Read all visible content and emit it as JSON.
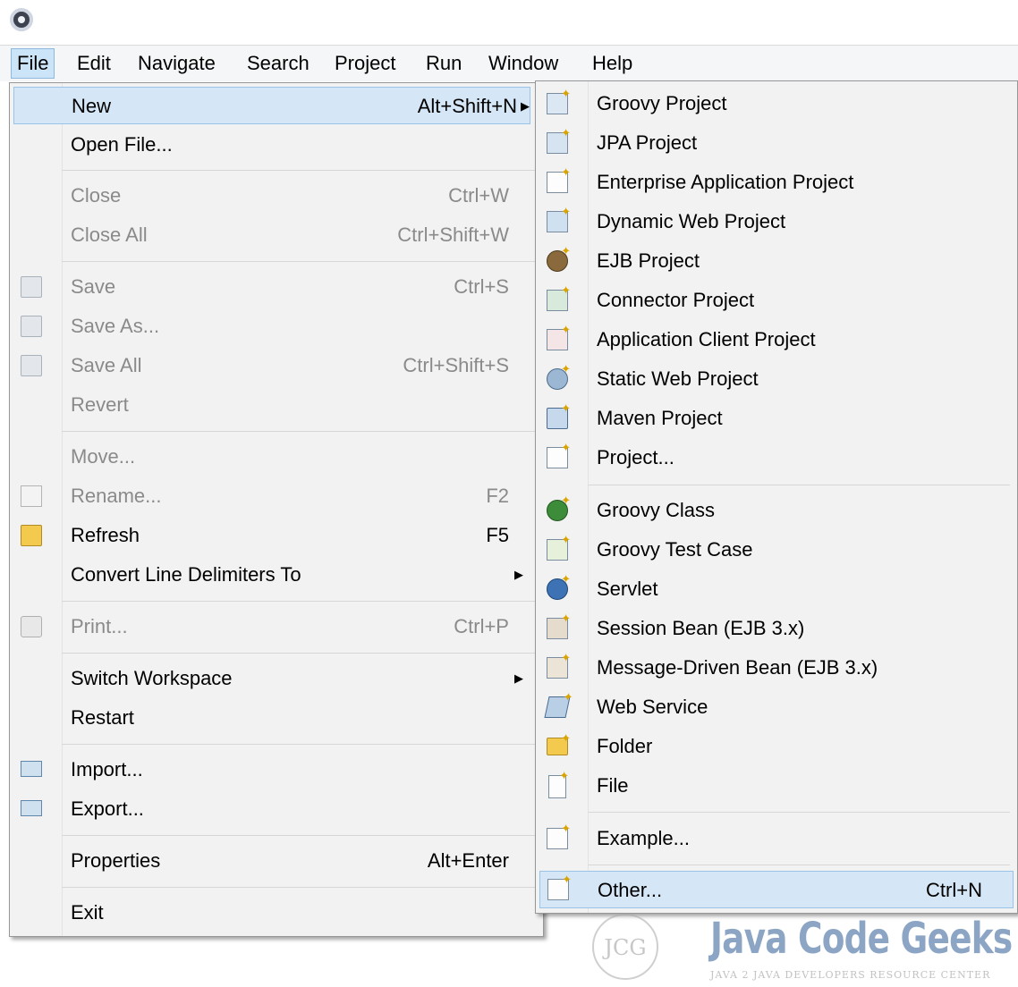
{
  "menubar": {
    "items": [
      "File",
      "Edit",
      "Navigate",
      "Search",
      "Project",
      "Run",
      "Window",
      "Help"
    ]
  },
  "file_menu": {
    "items": [
      {
        "label": "New",
        "accel": "Alt+Shift+N"
      },
      {
        "label": "Open File..."
      },
      {
        "label": "Close",
        "accel": "Ctrl+W"
      },
      {
        "label": "Close All",
        "accel": "Ctrl+Shift+W"
      },
      {
        "label": "Save",
        "accel": "Ctrl+S"
      },
      {
        "label": "Save As..."
      },
      {
        "label": "Save All",
        "accel": "Ctrl+Shift+S"
      },
      {
        "label": "Revert"
      },
      {
        "label": "Move..."
      },
      {
        "label": "Rename...",
        "accel": "F2"
      },
      {
        "label": "Refresh",
        "accel": "F5"
      },
      {
        "label": "Convert Line Delimiters To"
      },
      {
        "label": "Print...",
        "accel": "Ctrl+P"
      },
      {
        "label": "Switch Workspace"
      },
      {
        "label": "Restart"
      },
      {
        "label": "Import..."
      },
      {
        "label": "Export..."
      },
      {
        "label": "Properties",
        "accel": "Alt+Enter"
      },
      {
        "label": "Exit"
      }
    ]
  },
  "new_submenu": {
    "items": [
      {
        "label": "Groovy Project",
        "icon": "groovy-project-icon"
      },
      {
        "label": "JPA Project",
        "icon": "jpa-project-icon"
      },
      {
        "label": "Enterprise Application Project",
        "icon": "enterprise-application-project-icon"
      },
      {
        "label": "Dynamic Web Project",
        "icon": "dynamic-web-project-icon"
      },
      {
        "label": "EJB Project",
        "icon": "ejb-project-icon"
      },
      {
        "label": "Connector Project",
        "icon": "connector-project-icon"
      },
      {
        "label": "Application Client Project",
        "icon": "application-client-project-icon"
      },
      {
        "label": "Static Web Project",
        "icon": "static-web-project-icon"
      },
      {
        "label": "Maven Project",
        "icon": "maven-project-icon"
      },
      {
        "label": "Project...",
        "icon": "project-icon"
      },
      {
        "label": "Groovy Class",
        "icon": "groovy-class-icon"
      },
      {
        "label": "Groovy Test Case",
        "icon": "groovy-test-case-icon"
      },
      {
        "label": "Servlet",
        "icon": "servlet-icon"
      },
      {
        "label": "Session Bean (EJB 3.x)",
        "icon": "session-bean-icon"
      },
      {
        "label": "Message-Driven Bean (EJB 3.x)",
        "icon": "message-driven-bean-icon"
      },
      {
        "label": "Web Service",
        "icon": "web-service-icon"
      },
      {
        "label": "Folder",
        "icon": "folder-icon"
      },
      {
        "label": "File",
        "icon": "file-icon"
      },
      {
        "label": "Example...",
        "icon": "example-icon"
      },
      {
        "label": "Other...",
        "accel": "Ctrl+N",
        "icon": "other-wizard-icon"
      }
    ]
  },
  "watermark": {
    "logo_text": "JCG",
    "brand": "Java Code Geeks",
    "tagline": "JAVA 2 JAVA DEVELOPERS RESOURCE CENTER"
  },
  "colors": {
    "menu_bg": "#f2f2f2",
    "highlight": "#d5e6f6",
    "disabled_text": "#8a8a8a",
    "watermark_blue": "#2f5d96"
  }
}
